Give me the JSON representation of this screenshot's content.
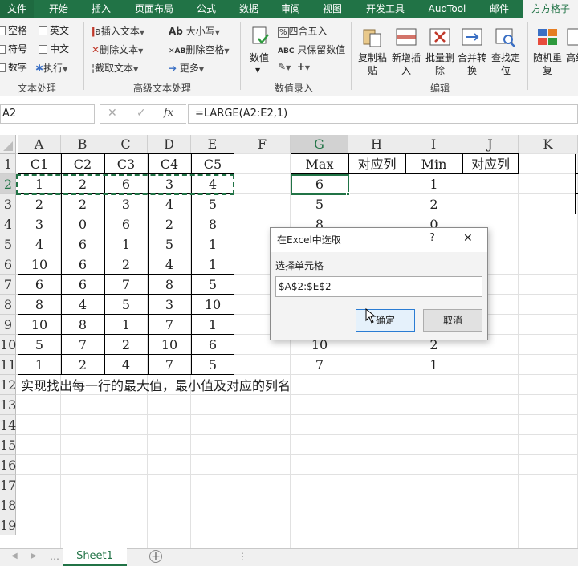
{
  "tabs": [
    "文件",
    "开始",
    "插入",
    "页面布局",
    "公式",
    "数据",
    "审阅",
    "视图",
    "开发工具",
    "AudTool",
    "邮件",
    "方方格子"
  ],
  "ribbon": {
    "text_group": {
      "checks": [
        "空格",
        "英文",
        "符号",
        "中文",
        "数字"
      ],
      "exec": "执行",
      "label": "文本处理"
    },
    "adv_text_group": {
      "items": [
        "插入文本",
        "删除文本",
        "截取文本",
        "大小写",
        "删除空格",
        "更多"
      ],
      "label": "高级文本处理"
    },
    "num_group": {
      "big": "数值",
      "items": [
        "四舍五入",
        "只保留数值"
      ],
      "label": "数值录入"
    },
    "edit_group": {
      "buttons": [
        "复制粘贴",
        "新增插入",
        "批量删除",
        "合并转换",
        "查找定位"
      ],
      "label": "编辑"
    },
    "extra": [
      "随机重复",
      "高级"
    ]
  },
  "name_box": "A2",
  "fx_icon": "fx",
  "formula": "=LARGE(A2:E2,1)",
  "columns": [
    "A",
    "B",
    "C",
    "D",
    "E",
    "F",
    "G",
    "H",
    "I",
    "J",
    "K"
  ],
  "rows": [
    "1",
    "2",
    "3",
    "4",
    "5",
    "6",
    "7",
    "8",
    "9",
    "10",
    "11",
    "12",
    "13",
    "14",
    "15",
    "16",
    "17",
    "18",
    "19"
  ],
  "headers_A_E": [
    "C1",
    "C2",
    "C3",
    "C4",
    "C5"
  ],
  "data_A_E": [
    [
      "1",
      "2",
      "6",
      "3",
      "4"
    ],
    [
      "2",
      "2",
      "3",
      "4",
      "5"
    ],
    [
      "3",
      "0",
      "6",
      "2",
      "8"
    ],
    [
      "4",
      "6",
      "1",
      "5",
      "1"
    ],
    [
      "10",
      "6",
      "2",
      "4",
      "1"
    ],
    [
      "6",
      "6",
      "7",
      "8",
      "5"
    ],
    [
      "8",
      "4",
      "5",
      "3",
      "10"
    ],
    [
      "10",
      "8",
      "1",
      "7",
      "1"
    ],
    [
      "5",
      "7",
      "2",
      "10",
      "6"
    ],
    [
      "1",
      "2",
      "4",
      "7",
      "5"
    ]
  ],
  "headers_G_J": [
    "Max",
    "对应列",
    "Min",
    "对应列"
  ],
  "max_values": [
    "6",
    "5",
    "8",
    "",
    "",
    "",
    "",
    "",
    "10",
    "7"
  ],
  "min_values": [
    "1",
    "2",
    "0",
    "",
    "",
    "",
    "",
    "",
    "2",
    "1"
  ],
  "note": "实现找出每一行的最大值，最小值及对应的列名",
  "sheet_tab": "Sheet1",
  "dialog": {
    "title": "在Excel中选取",
    "help": "?",
    "close": "✕",
    "label": "选择单元格",
    "value": "$A$2:$E$2",
    "ok": "确定",
    "cancel": "取消"
  },
  "colors": {
    "excel_green": "#217346",
    "selection_green": "#217346"
  }
}
